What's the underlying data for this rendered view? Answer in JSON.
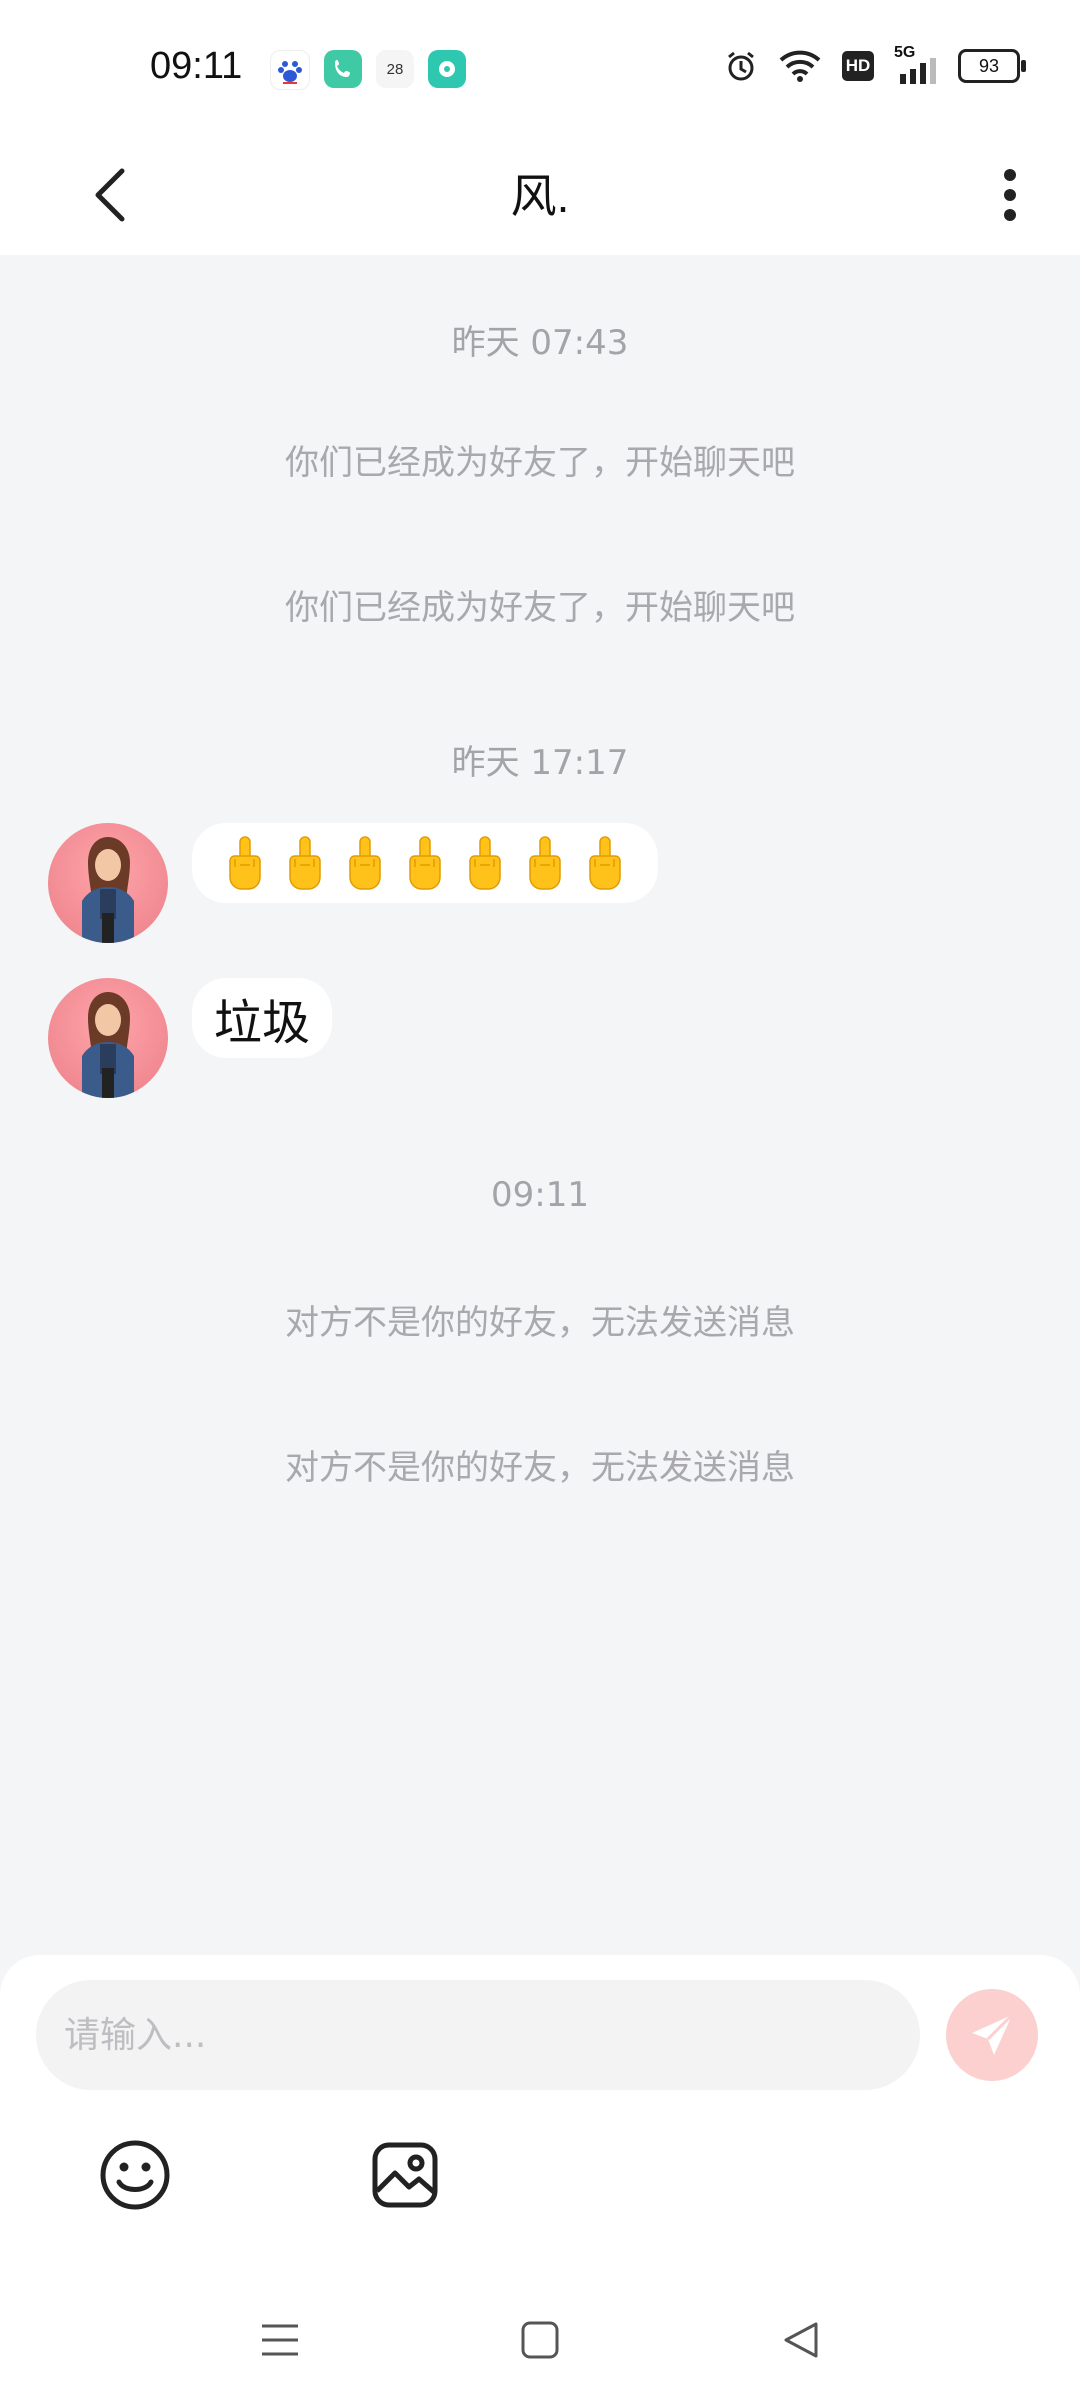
{
  "status_bar": {
    "time": "09:11",
    "apps": [
      {
        "icon": "baidu-app-icon",
        "label": "du",
        "color": "#ffffff"
      },
      {
        "icon": "phone-app-icon",
        "label": "",
        "color": "#3fc9a4"
      },
      {
        "icon": "calendar-app-icon",
        "label": "28",
        "color": "#f5f5f5"
      },
      {
        "icon": "message-app-icon",
        "label": "",
        "color": "#2ec8b0"
      }
    ],
    "indicators": [
      "alarm-icon",
      "wifi-icon",
      "hd-icon",
      "signal-5g-icon"
    ],
    "hd_label": "HD",
    "network_label": "5G",
    "battery_level": "93"
  },
  "header": {
    "title": "风.",
    "back_icon": "chevron-left-icon",
    "more_icon": "more-vertical-icon"
  },
  "messages": {
    "timestamp_1": "昨天 07:43",
    "system_1": "你们已经成为好友了，开始聊天吧",
    "system_2": "你们已经成为好友了，开始聊天吧",
    "timestamp_2": "昨天 17:17",
    "emoji_message": {
      "emoji": "middle-finger-emoji",
      "count": 7
    },
    "text_message": "垃圾",
    "timestamp_3": "09:11",
    "system_3": "对方不是你的好友，无法发送消息",
    "system_4": "对方不是你的好友，无法发送消息"
  },
  "composer": {
    "placeholder": "请输入...",
    "send_icon": "send-icon",
    "emoji_icon": "smiley-icon",
    "image_icon": "image-icon",
    "accent": "#f7a6a6"
  },
  "nav": {
    "menu_icon": "menu-icon",
    "home_icon": "home-square-icon",
    "back_icon": "back-triangle-icon"
  }
}
